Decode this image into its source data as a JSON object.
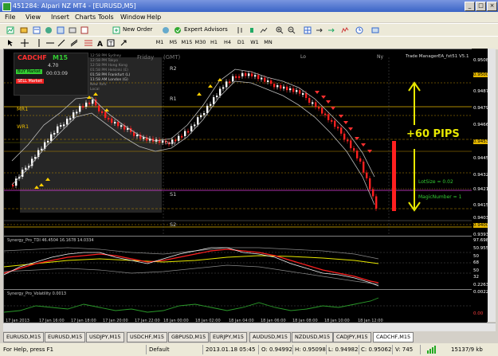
{
  "window": {
    "title": "451284: Alpari NZ MT4 - [EURUSD,M5]",
    "min": "_",
    "max": "□",
    "close": "×"
  },
  "menu": [
    "File",
    "View",
    "Insert",
    "Charts",
    "Tools",
    "Window",
    "Help"
  ],
  "toolbar": {
    "new_order": "New Order",
    "expert_advisors": "Expert Advisors",
    "timeframes": [
      "M1",
      "M5",
      "M15",
      "M30",
      "H1",
      "H4",
      "D1",
      "W1",
      "MN"
    ]
  },
  "chart": {
    "symbol": "CADCHF",
    "timeframe": "M15",
    "timer": "00:03:09",
    "small_value": "4.70",
    "buy_label": "BUY Market",
    "sell_label": "SELL Market",
    "day_label": "Friday",
    "gmt_label": "(GMT)",
    "lo_label": "Lo",
    "ny_label": "Ny",
    "ea_label": "Trade ManagerEA_fxt51 V5.1",
    "levels": {
      "r2": "R2",
      "r1": "R1",
      "mr1": "MR1",
      "wr1": "WR1",
      "s1": "S1",
      "s2": "S2",
      "daily": "Daily"
    },
    "sessions": [
      {
        "time": "12:58 PM",
        "city": "Sydney"
      },
      {
        "time": "12:58 PM",
        "city": "Tokyo"
      },
      {
        "time": "12:58 PM",
        "city": "Hong Kong"
      },
      {
        "time": "01:58 PM",
        "city": "Helsinki (E)"
      },
      {
        "time": "01:58 PM",
        "city": "Frankfurt (L)"
      },
      {
        "time": "11:58 AM",
        "city": "London (G)"
      },
      {
        "time": "",
        "city": "New York"
      },
      {
        "time": "",
        "city": "Local"
      }
    ],
    "pips_text": "+60 PIPS",
    "lotsize_text": "LotSize = 0.02",
    "magic_text": "MagicNumber = 1",
    "tdi_label": "Synergy_Pro_TDI 46.4504 16.1678 14.0334",
    "vol_label": "Synergy_Pro_Volatility 0.0013",
    "prices": [
      "0.95085",
      "0.95000",
      "0.94875",
      "0.94795",
      "0.94665",
      "0.94530",
      "0.94455",
      "0.94325",
      "0.94215",
      "0.94155",
      "0.94035",
      "0.94000",
      "0.93930"
    ],
    "tdi_scale": [
      "97.6984",
      "50.9554",
      "50",
      "68",
      "50",
      "32",
      "0.2263"
    ],
    "vol_scale": [
      "0.0022",
      "0.00"
    ],
    "time_axis": [
      "17 Jan 2013",
      "17 Jan 16:00",
      "17 Jan 18:00",
      "17 Jan 20:00",
      "17 Jan 22:00",
      "18 Jan 00:00",
      "18 Jan 02:00",
      "18 Jan 04:00",
      "18 Jan 06:00",
      "18 Jan 08:00",
      "18 Jan 10:00",
      "18 Jan 12:00"
    ]
  },
  "tabs": [
    "EURUSD,M15",
    "EURUSD,M15",
    "USDJPY,M15",
    "USDCHF,M15",
    "GBPUSD,M15",
    "EURJPY,M15",
    "AUDUSD,M15",
    "NZDUSD,M15",
    "CADJPY,M15",
    "CADCHF,M15"
  ],
  "active_tab": 9,
  "status": {
    "help": "For Help, press F1",
    "profile": "Default",
    "datetime": "2013.01.18 05:45",
    "open": "O: 0.94992",
    "high": "H: 0.95098",
    "low": "L: 0.94982",
    "close": "C: 0.95062",
    "volume": "V: 745",
    "traffic": "15137/9 kb"
  },
  "colors": {
    "bull": "#ffffff",
    "bear": "#ff2020",
    "pips": "#e8e800",
    "level": "#d8a000",
    "tdi_red": "#ff2020",
    "tdi_yellow": "#e8e800"
  }
}
